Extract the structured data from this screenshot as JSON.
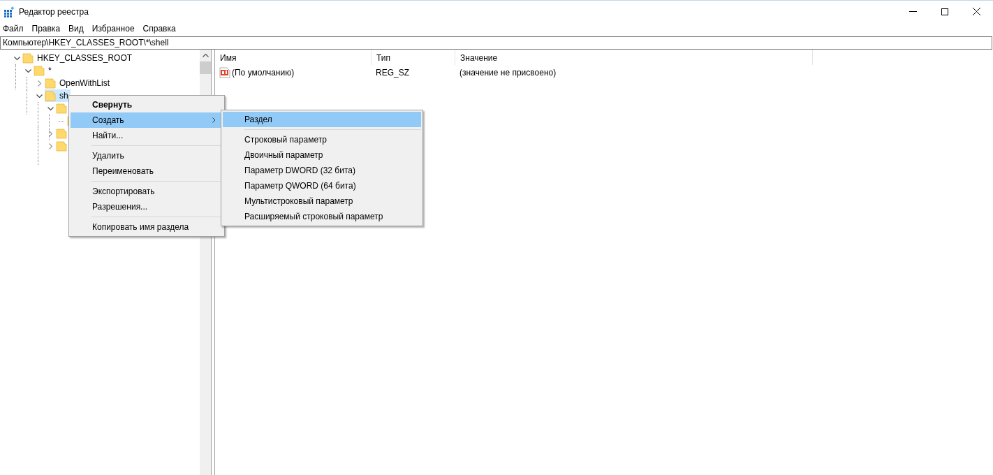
{
  "window": {
    "title": "Редактор реестра"
  },
  "menu_bar": [
    "Файл",
    "Правка",
    "Вид",
    "Избранное",
    "Справка"
  ],
  "address_bar": {
    "value": "Компьютер\\HKEY_CLASSES_ROOT\\*\\shell"
  },
  "tree": [
    {
      "label": "HKEY_CLASSES_ROOT",
      "expandable": true,
      "expanded": true,
      "selected": false,
      "children": [
        {
          "label": "*",
          "expandable": true,
          "expanded": true,
          "selected": false,
          "children": [
            {
              "label": "OpenWithList",
              "expandable": true,
              "expanded": false,
              "selected": false
            },
            {
              "label": "sh",
              "expandable": true,
              "expanded": true,
              "selected": true,
              "children": [
                {
                  "expandable": true,
                  "expanded": true,
                  "selected": false,
                  "children": [
                    {
                      "expandable": false,
                      "selected": false
                    }
                  ]
                },
                {
                  "expandable": true,
                  "expanded": false,
                  "selected": false
                },
                {
                  "expandable": true,
                  "expanded": false,
                  "selected": false
                }
              ]
            }
          ]
        }
      ]
    }
  ],
  "values_table": {
    "columns": [
      "Имя",
      "Тип",
      "Значение"
    ],
    "rows": [
      {
        "name": "(По умолчанию)",
        "type": "REG_SZ",
        "data": "(значение не присвоено)"
      }
    ]
  },
  "context_menu": [
    {
      "kind": "item",
      "label": "Свернуть",
      "bold": true,
      "selected": false,
      "submenu": false
    },
    {
      "kind": "item",
      "label": "Создать",
      "bold": false,
      "selected": true,
      "submenu": true
    },
    {
      "kind": "item",
      "label": "Найти...",
      "bold": false,
      "selected": false,
      "submenu": false
    },
    {
      "kind": "separator"
    },
    {
      "kind": "item",
      "label": "Удалить",
      "bold": false,
      "selected": false,
      "submenu": false
    },
    {
      "kind": "item",
      "label": "Переименовать",
      "bold": false,
      "selected": false,
      "submenu": false
    },
    {
      "kind": "separator"
    },
    {
      "kind": "item",
      "label": "Экспортировать",
      "bold": false,
      "selected": false,
      "submenu": false
    },
    {
      "kind": "item",
      "label": "Разрешения...",
      "bold": false,
      "selected": false,
      "submenu": false
    },
    {
      "kind": "separator"
    },
    {
      "kind": "item",
      "label": "Копировать имя раздела",
      "bold": false,
      "selected": false,
      "submenu": false
    }
  ],
  "submenu": [
    {
      "kind": "item",
      "label": "Раздел",
      "bold": false,
      "selected": true,
      "submenu": false
    },
    {
      "kind": "separator"
    },
    {
      "kind": "item",
      "label": "Строковый параметр",
      "bold": false,
      "selected": false,
      "submenu": false
    },
    {
      "kind": "item",
      "label": "Двоичный параметр",
      "bold": false,
      "selected": false,
      "submenu": false
    },
    {
      "kind": "item",
      "label": "Параметр DWORD (32 бита)",
      "bold": false,
      "selected": false,
      "submenu": false
    },
    {
      "kind": "item",
      "label": "Параметр QWORD (64 бита)",
      "bold": false,
      "selected": false,
      "submenu": false
    },
    {
      "kind": "item",
      "label": "Мультистроковый параметр",
      "bold": false,
      "selected": false,
      "submenu": false
    },
    {
      "kind": "item",
      "label": "Расширяемый строковый параметр",
      "bold": false,
      "selected": false,
      "submenu": false
    }
  ]
}
